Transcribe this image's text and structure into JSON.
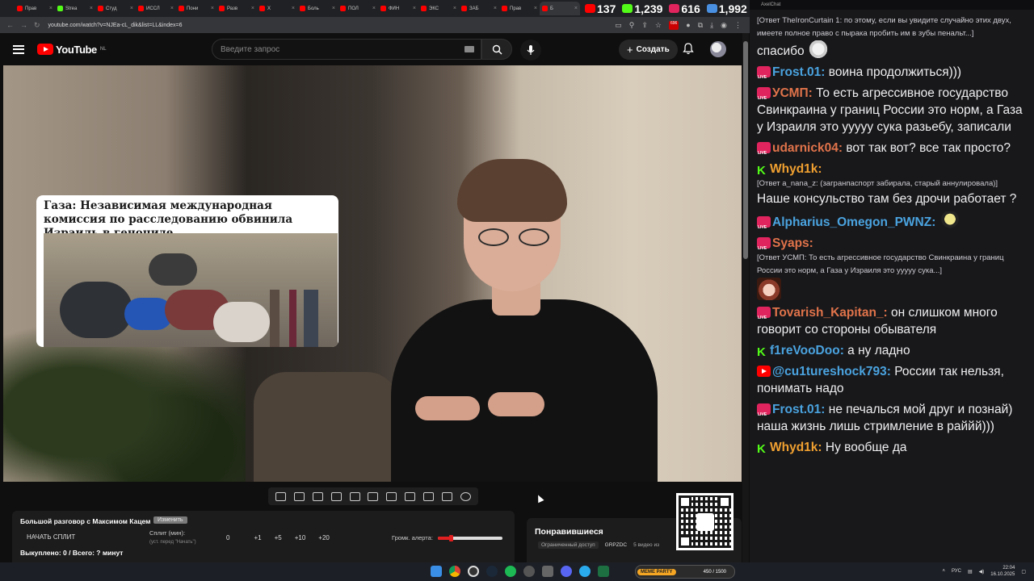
{
  "browser": {
    "tabs": [
      {
        "label": "Прав",
        "color": "#ff0000"
      },
      {
        "label": "Strea",
        "color": "#53fc18"
      },
      {
        "label": "Студ",
        "color": "#ff0000"
      },
      {
        "label": "ИССЛ",
        "color": "#ff0000"
      },
      {
        "label": "Пони",
        "color": "#ff0000"
      },
      {
        "label": "Разв",
        "color": "#ff0000"
      },
      {
        "label": "Х",
        "color": "#ff0000"
      },
      {
        "label": "Боль",
        "color": "#ff0000"
      },
      {
        "label": "ПОЛ",
        "color": "#ff0000"
      },
      {
        "label": "ФИН",
        "color": "#ff0000"
      },
      {
        "label": "ЭКС",
        "color": "#ff0000"
      },
      {
        "label": "ЗАБ",
        "color": "#ff0000"
      },
      {
        "label": "Прав",
        "color": "#ff0000"
      },
      {
        "label": "Б",
        "color": "#ff0000"
      }
    ],
    "url": "youtube.com/watch?v=NJEa-cL_dik&list=LL&index=6",
    "ext_badge": "696"
  },
  "viewers": [
    {
      "platform": "youtube",
      "count": "137",
      "color": "#ff0000"
    },
    {
      "platform": "kick",
      "count": "1,239",
      "color": "#53fc18"
    },
    {
      "platform": "vk-live",
      "count": "616",
      "color": "#e0245e"
    },
    {
      "platform": "total",
      "count": "1,992",
      "color": "#4a90e2"
    }
  ],
  "youtube": {
    "logo_text": "YouTube",
    "region": "NL",
    "search_placeholder": "Введите запрос",
    "create_label": "Создать"
  },
  "video": {
    "news_headline": "Газа: Независимая международная комиссия по расследованию обвинила Израиль в геноциде"
  },
  "overlay": {
    "stream_title": "Большой разговор с Максимом Кацем",
    "edit_label": "Изменить",
    "start_split": "НАЧАТЬ СПЛИТ",
    "split_label": "Сплит (мин):",
    "split_hint": "(уст. перед \"Начать\")",
    "split_values": [
      "0",
      "+1",
      "+5",
      "+10",
      "+20"
    ],
    "alert_volume_label": "Громк. алерта:",
    "alert_volume": 0.2,
    "bought_label": "Выкуплено: 0 / Всего: ? минут"
  },
  "liked": {
    "title": "Понравившиеся",
    "access": "Ограниченный доступ",
    "channel": "GRPZDC",
    "count": "5 видео из"
  },
  "chat": {
    "window_title": "AxelChat",
    "messages": [
      {
        "platform": "none",
        "name": "",
        "name_color": "#ffffff",
        "reply": "[Ответ TheIronCurtain 1: по этому, если вы увидите случайно этих двух, имеете полное право с пырака пробить им в зубы пенальт...]",
        "text": "спасибо",
        "emote": "goose"
      },
      {
        "platform": "live",
        "name": "Frost.01:",
        "name_color": "#4aa3df",
        "reply": "",
        "text": "воина продолжиться)))",
        "emote": ""
      },
      {
        "platform": "live",
        "name": "УСМП:",
        "name_color": "#e0734a",
        "reply": "",
        "text": "То есть агрессивное государство Свинкраина у границ России это норм, а Газа у Израиля это ууууу сука разьебу, записали",
        "emote": ""
      },
      {
        "platform": "live",
        "name": "udarnick04:",
        "name_color": "#e0734a",
        "reply": "",
        "text": "вот так вот? все так просто?",
        "emote": ""
      },
      {
        "platform": "kick",
        "name": "Whyd1k:",
        "name_color": "#f0a030",
        "reply": "[Ответ a_nana_z: (загранпаспорт забирала, старый аннулировала)]",
        "text": "Наше консульство там без дрочи работает ?",
        "emote": ""
      },
      {
        "platform": "live",
        "name": "Alpharius_Omegon_PWNZ:",
        "name_color": "#4aa3df",
        "reply": "",
        "text": "",
        "emote": "ghost"
      },
      {
        "platform": "live",
        "name": "Syaps:",
        "name_color": "#e0734a",
        "reply": "[Ответ УСМП: То есть агрессивное государство Свинкраина у границ России это норм, а Газа у Израиля это ууууу сука...]",
        "text": "",
        "emote": "anime"
      },
      {
        "platform": "live",
        "name": "Tovarish_Kapitan_:",
        "name_color": "#e0734a",
        "reply": "",
        "text": "он слишком много говорит со стороны обывателя",
        "emote": ""
      },
      {
        "platform": "kick",
        "name": "f1reVooDoo:",
        "name_color": "#4aa3df",
        "reply": "",
        "text": "а ну ладно",
        "emote": ""
      },
      {
        "platform": "yt",
        "name": "@cu1tureshock793:",
        "name_color": "#4aa3df",
        "reply": "",
        "text": "России так нельзя, понимать надо",
        "emote": ""
      },
      {
        "platform": "live",
        "name": "Frost.01:",
        "name_color": "#4aa3df",
        "reply": "",
        "text": "не печалься мой друг и познай) наша жизнь лишь стримление в раййй)))",
        "emote": ""
      },
      {
        "platform": "kick",
        "name": "Whyd1k:",
        "name_color": "#f0a030",
        "reply": "",
        "text": "Ну вообще да",
        "emote": ""
      }
    ]
  },
  "taskbar": {
    "meme_tag": "MEME PARTY",
    "meme_count": "450 / 1500",
    "lang": "РУС",
    "time": "22:04",
    "date": "16.10.2025"
  }
}
